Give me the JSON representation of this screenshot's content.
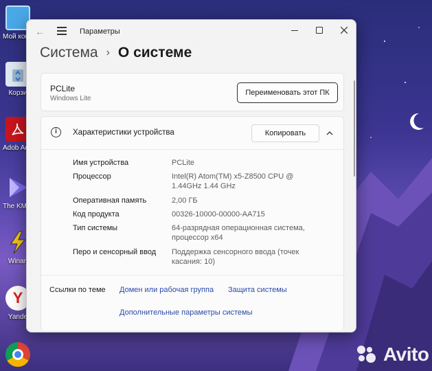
{
  "desktop": {
    "icons": [
      {
        "name": "pc",
        "label": "Мой компью..."
      },
      {
        "name": "recycle",
        "label": "Корзи"
      },
      {
        "name": "acrobat",
        "label": "Adob Acrob"
      },
      {
        "name": "kmplayer",
        "label": "The KMPlay"
      },
      {
        "name": "winamp",
        "label": "Winan"
      },
      {
        "name": "yandex",
        "label": "Yande"
      },
      {
        "name": "chrome",
        "label": ""
      }
    ]
  },
  "watermark": {
    "text": "Avito"
  },
  "window": {
    "title": "Параметры",
    "breadcrumb": {
      "parent": "Система",
      "current": "О системе"
    },
    "device_card": {
      "name": "PCLite",
      "subtitle": "Windows Lite",
      "rename_label": "Переименовать этот ПК"
    },
    "specs": {
      "title": "Характеристики устройства",
      "copy_label": "Копировать",
      "rows": [
        {
          "key": "Имя устройства",
          "value": "PCLite"
        },
        {
          "key": "Процессор",
          "value": "Intel(R) Atom(TM) x5-Z8500 CPU @ 1.44GHz 1.44 GHz"
        },
        {
          "key": "Оперативная память",
          "value": "2,00 ГБ"
        },
        {
          "key": "Код продукта",
          "value": "00326-10000-00000-AA715"
        },
        {
          "key": "Тип системы",
          "value": "64-разрядная операционная система, процессор x64"
        },
        {
          "key": "Перо и сенсорный ввод",
          "value": "Поддержка сенсорного ввода (точек касания: 10)"
        }
      ]
    },
    "related": {
      "title": "Ссылки по теме",
      "links": [
        "Домен или рабочая группа",
        "Защита системы",
        "Дополнительные параметры системы"
      ]
    }
  },
  "colors": {
    "accent_link": "#2b4aa8",
    "window_bg": "#f3f3f3"
  }
}
